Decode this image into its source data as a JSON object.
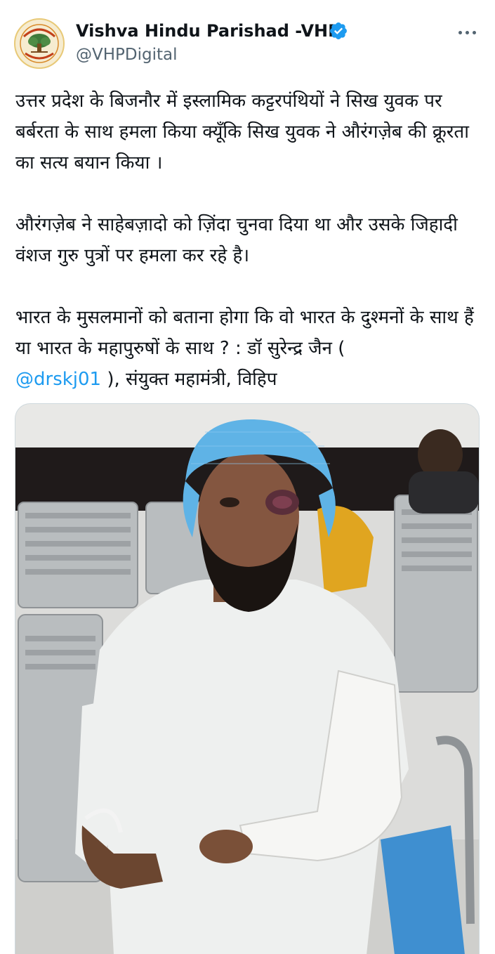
{
  "author": {
    "name": "Vishva Hindu Parishad -VHP",
    "handle": "@VHPDigital",
    "verified": true,
    "avatar_icon": "vhp-logo-avatar",
    "avatar_text_top": "विश्व हिन्दू परिषद",
    "avatar_text_bottom": "धर्मो रक्षति रक्षितः"
  },
  "menu": {
    "icon": "more-options-icon"
  },
  "tweet": {
    "paragraph1": "उत्तर प्रदेश के बिजनौर में इस्लामिक कट्टरपंथियों ने सिख युवक पर बर्बरता के साथ हमला किया क्यूँकि सिख युवक ने औरंगज़ेब की क्रूरता का सत्य बयान किया ।",
    "paragraph2": "औरंगज़ेब ने साहेबज़ादो को ज़िंदा चुनवा दिया था और उसके जिहादी वंशज गुरु पुत्रों पर हमला कर रहे है।",
    "paragraph3_text": "भारत के मुसलमानों को बताना होगा कि वो भारत के दुश्मनों के साथ हैं या भारत के महापुरुषों के साथ ? : डॉ सुरेन्द्र जैन (",
    "paragraph3_mention": "@drskj01",
    "paragraph3_tail": " ), संयुक्त महामंत्री, विहिप"
  },
  "colors": {
    "text": "#0f1419",
    "secondary": "#536471",
    "link": "#1d9bf0",
    "verified": "#1d9bf0"
  },
  "media": {
    "type": "photo",
    "subject": "injured young man in hospital waiting area wearing blue surgical cap, white shirt, arm in plaster cast"
  }
}
